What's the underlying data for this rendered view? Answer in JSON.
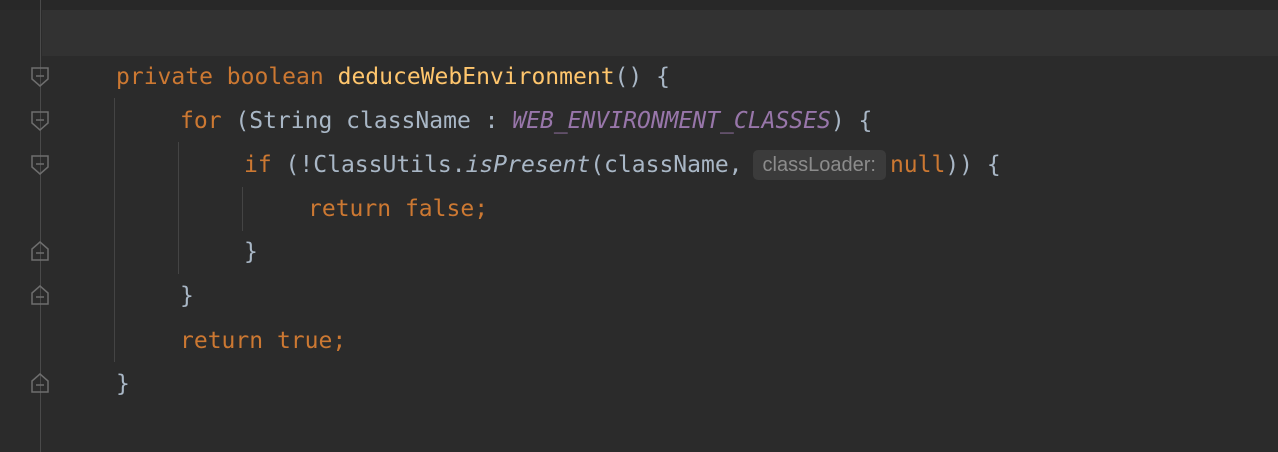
{
  "editor": {
    "lines": [
      {
        "kw1": "private",
        "kw2": "boolean",
        "method": "deduceWebEnvironment",
        "rest": "() {"
      },
      {
        "kw": "for",
        "open": " (String className : ",
        "const": "WEB_ENVIRONMENT_CLASSES",
        "close": ") {"
      },
      {
        "kw": "if",
        "open": " (!ClassUtils.",
        "method": "isPresent",
        "args": "(className,",
        "hint": "classLoader:",
        "null": "null",
        "close": ")) {"
      },
      {
        "kw": "return",
        "value": " false",
        "semi": ";"
      },
      {
        "brace": "}"
      },
      {
        "brace": "}"
      },
      {
        "kw": "return",
        "value": " true",
        "semi": ";"
      },
      {
        "brace": "}"
      }
    ]
  },
  "colors": {
    "background": "#2b2b2b",
    "keyword": "#cc7832",
    "method": "#ffc66d",
    "constant": "#9876aa",
    "text": "#a9b7c6",
    "hint": "#8c8c8c"
  },
  "icons": [
    "fold-open-icon",
    "fold-close-icon"
  ]
}
